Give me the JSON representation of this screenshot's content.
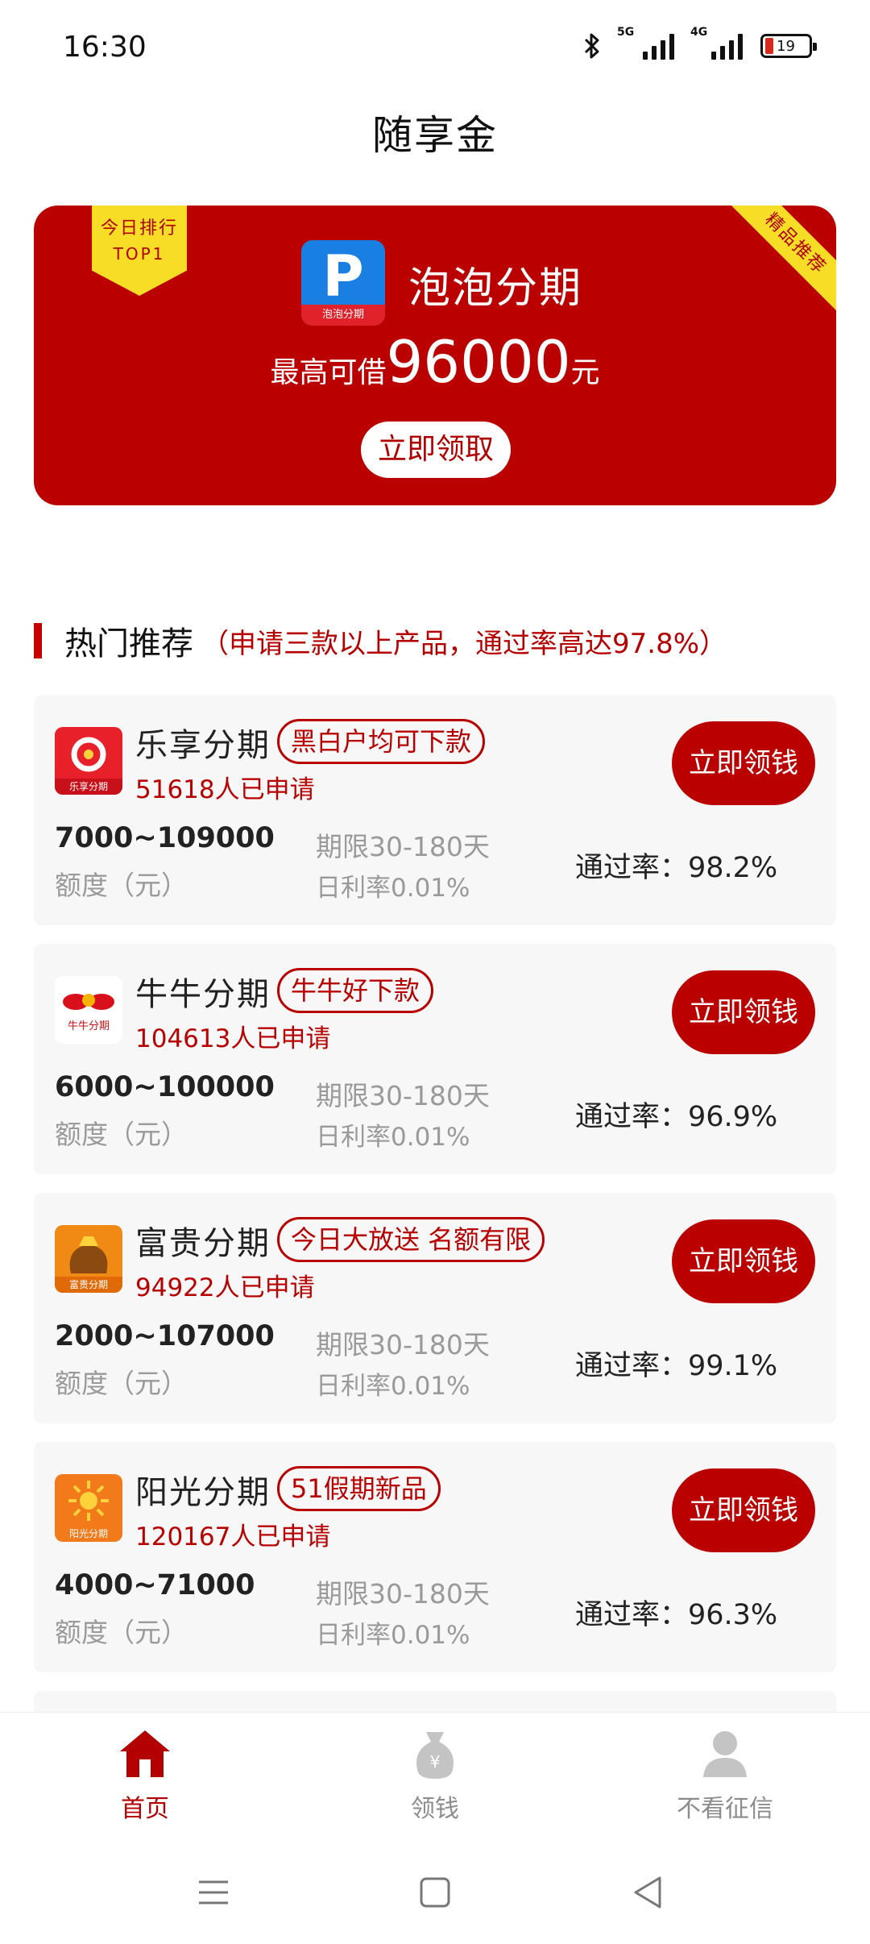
{
  "status_bar": {
    "time": "16:30",
    "signal1_label": "5G",
    "signal2_label": "4G",
    "battery_level": "19",
    "icons": [
      "bluetooth-icon",
      "signal-5g-icon",
      "signal-4g-icon",
      "battery-icon"
    ]
  },
  "app": {
    "title": "随享金"
  },
  "hero": {
    "rank_line1": "今日排行",
    "rank_line2": "TOP1",
    "ribbon": "精品推荐",
    "logo_letter": "P",
    "logo_caption": "泡泡分期",
    "name": "泡泡分期",
    "amount_prefix": "最高可借",
    "amount": "96000",
    "amount_unit": "元",
    "button": "立即领取",
    "colors": {
      "background": "#bb0000",
      "badge": "#f7dd26",
      "logo": "#1a7fe3"
    }
  },
  "section": {
    "title": "热门推荐",
    "subtitle": "（申请三款以上产品，通过率高达97.8%）"
  },
  "products": [
    {
      "name": "乐享分期",
      "tag": "黑白户均可下款",
      "applied": "51618人已申请",
      "button": "立即领钱",
      "range": "7000~109000",
      "range_label": "额度（元）",
      "term": "期限30-180天",
      "rate": "日利率0.01%",
      "pass_rate": "通过率：98.2%",
      "logo_icon": "lexiang-logo-icon",
      "logo_caption": "乐享分期"
    },
    {
      "name": "牛牛分期",
      "tag": "牛牛好下款",
      "applied": "104613人已申请",
      "button": "立即领钱",
      "range": "6000~100000",
      "range_label": "额度（元）",
      "term": "期限30-180天",
      "rate": "日利率0.01%",
      "pass_rate": "通过率：96.9%",
      "logo_icon": "bull-logo-icon",
      "logo_caption": "牛牛分期"
    },
    {
      "name": "富贵分期",
      "tag": "今日大放送 名额有限",
      "applied": "94922人已申请",
      "button": "立即领钱",
      "range": "2000~107000",
      "range_label": "额度（元）",
      "term": "期限30-180天",
      "rate": "日利率0.01%",
      "pass_rate": "通过率：99.1%",
      "logo_icon": "treasure-bag-logo-icon",
      "logo_caption": "富贵分期"
    },
    {
      "name": "阳光分期",
      "tag": "51假期新品",
      "applied": "120167人已申请",
      "button": "立即领钱",
      "range": "4000~71000",
      "range_label": "额度（元）",
      "term": "期限30-180天",
      "rate": "日利率0.01%",
      "pass_rate": "通过率：96.3%",
      "logo_icon": "sun-logo-icon",
      "logo_caption": "阳光分期"
    }
  ],
  "bottom_nav": {
    "items": [
      {
        "label": "首页",
        "icon": "home-icon",
        "active": true
      },
      {
        "label": "领钱",
        "icon": "money-bag-icon",
        "active": false
      },
      {
        "label": "不看征信",
        "icon": "user-icon",
        "active": false
      }
    ],
    "active_color": "#b30000",
    "inactive_color": "#8c8c8c"
  },
  "system_nav": {
    "icons": [
      "menu-icon",
      "home-square-icon",
      "back-icon"
    ]
  }
}
